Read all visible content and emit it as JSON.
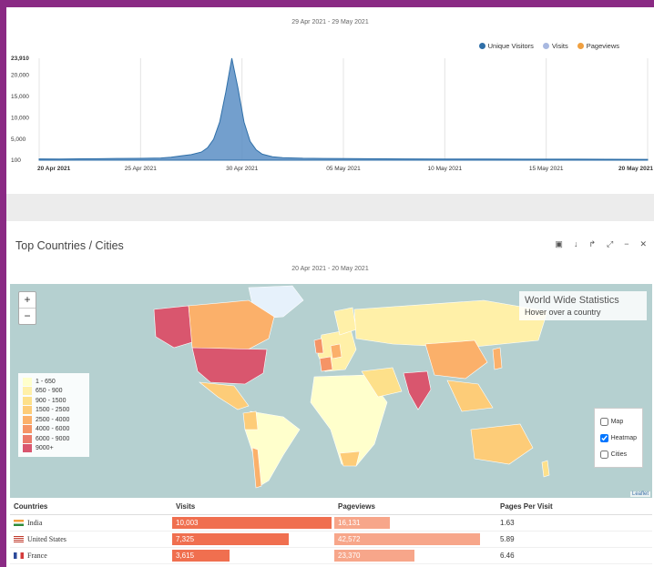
{
  "traffic": {
    "date_range": "29 Apr 2021 - 29 May 2021",
    "legend": [
      {
        "label": "Unique Visitors",
        "color": "#2f6fa8"
      },
      {
        "label": "Visits",
        "color": "#a8b8e0"
      },
      {
        "label": "Pageviews",
        "color": "#f0a040"
      }
    ],
    "chart_data": {
      "type": "area",
      "title": "",
      "xlabel": "",
      "ylabel": "",
      "ylim": [
        100,
        23910
      ],
      "yticks": [
        "23,910",
        "20,000",
        "15,000",
        "10,000",
        "5,000",
        "100"
      ],
      "ytick_values": [
        23910,
        20000,
        15000,
        10000,
        5000,
        100
      ],
      "xticks": [
        "20 Apr 2021",
        "25 Apr 2021",
        "30 Apr 2021",
        "05 May 2021",
        "10 May 2021",
        "15 May 2021",
        "20 May 2021"
      ],
      "series": [
        {
          "name": "Unique Visitors",
          "values": [
            [
              0,
              400
            ],
            [
              1,
              380
            ],
            [
              2,
              420
            ],
            [
              3,
              450
            ],
            [
              4,
              500
            ],
            [
              5,
              520
            ],
            [
              6,
              600
            ],
            [
              6.5,
              800
            ],
            [
              7,
              1100
            ],
            [
              7.5,
              1400
            ],
            [
              8,
              2000
            ],
            [
              8.3,
              3000
            ],
            [
              8.6,
              5000
            ],
            [
              8.9,
              9000
            ],
            [
              9.2,
              16000
            ],
            [
              9.5,
              23910
            ],
            [
              9.8,
              17000
            ],
            [
              10.1,
              9000
            ],
            [
              10.4,
              4500
            ],
            [
              10.7,
              2500
            ],
            [
              11,
              1500
            ],
            [
              11.5,
              900
            ],
            [
              12,
              700
            ],
            [
              13,
              550
            ],
            [
              14,
              500
            ],
            [
              16,
              450
            ],
            [
              18,
              400
            ],
            [
              20,
              380
            ],
            [
              22,
              360
            ],
            [
              24,
              340
            ],
            [
              26,
              330
            ],
            [
              28,
              320
            ],
            [
              30,
              300
            ]
          ]
        }
      ],
      "x_span": [
        0,
        30
      ]
    }
  },
  "countries": {
    "title": "Top Countries / Cities",
    "date_range": "20 Apr 2021 - 20 May 2021",
    "tools": [
      "▣",
      "↓",
      "↱",
      "⤢",
      "−",
      "✕"
    ],
    "map": {
      "zoom_in": "+",
      "zoom_out": "−",
      "info_title": "World Wide Statistics",
      "info_sub": "Hover over a country",
      "legend": [
        {
          "label": "1 - 650",
          "color": "#ffffcc"
        },
        {
          "label": "650 - 900",
          "color": "#fff0a8"
        },
        {
          "label": "900 - 1500",
          "color": "#fde08a"
        },
        {
          "label": "1500 - 2500",
          "color": "#fdcc78"
        },
        {
          "label": "2500 - 4000",
          "color": "#fbb06a"
        },
        {
          "label": "4000 - 6000",
          "color": "#f59466"
        },
        {
          "label": "6000 - 9000",
          "color": "#eb7a6a"
        },
        {
          "label": "9000+",
          "color": "#d9566e"
        }
      ],
      "layers": [
        {
          "label": "Map",
          "checked": false
        },
        {
          "label": "Heatmap",
          "checked": true
        },
        {
          "label": "Cities",
          "checked": false
        }
      ],
      "attribution": "Leaflet"
    },
    "table": {
      "headers": [
        "Countries",
        "Visits",
        "Pageviews",
        "Pages Per Visit"
      ],
      "rows": [
        {
          "country": "India",
          "visits": "10,003",
          "visits_frac": 1.0,
          "pageviews": "16,131",
          "pv_frac": 0.38,
          "ppv": "1.63",
          "flag": "in"
        },
        {
          "country": "United States",
          "visits": "7,325",
          "visits_frac": 0.73,
          "pageviews": "42,572",
          "pv_frac": 1.0,
          "ppv": "5.89",
          "flag": "us"
        },
        {
          "country": "France",
          "visits": "3,615",
          "visits_frac": 0.36,
          "pageviews": "23,370",
          "pv_frac": 0.55,
          "ppv": "6.46",
          "flag": "fr"
        }
      ]
    }
  }
}
